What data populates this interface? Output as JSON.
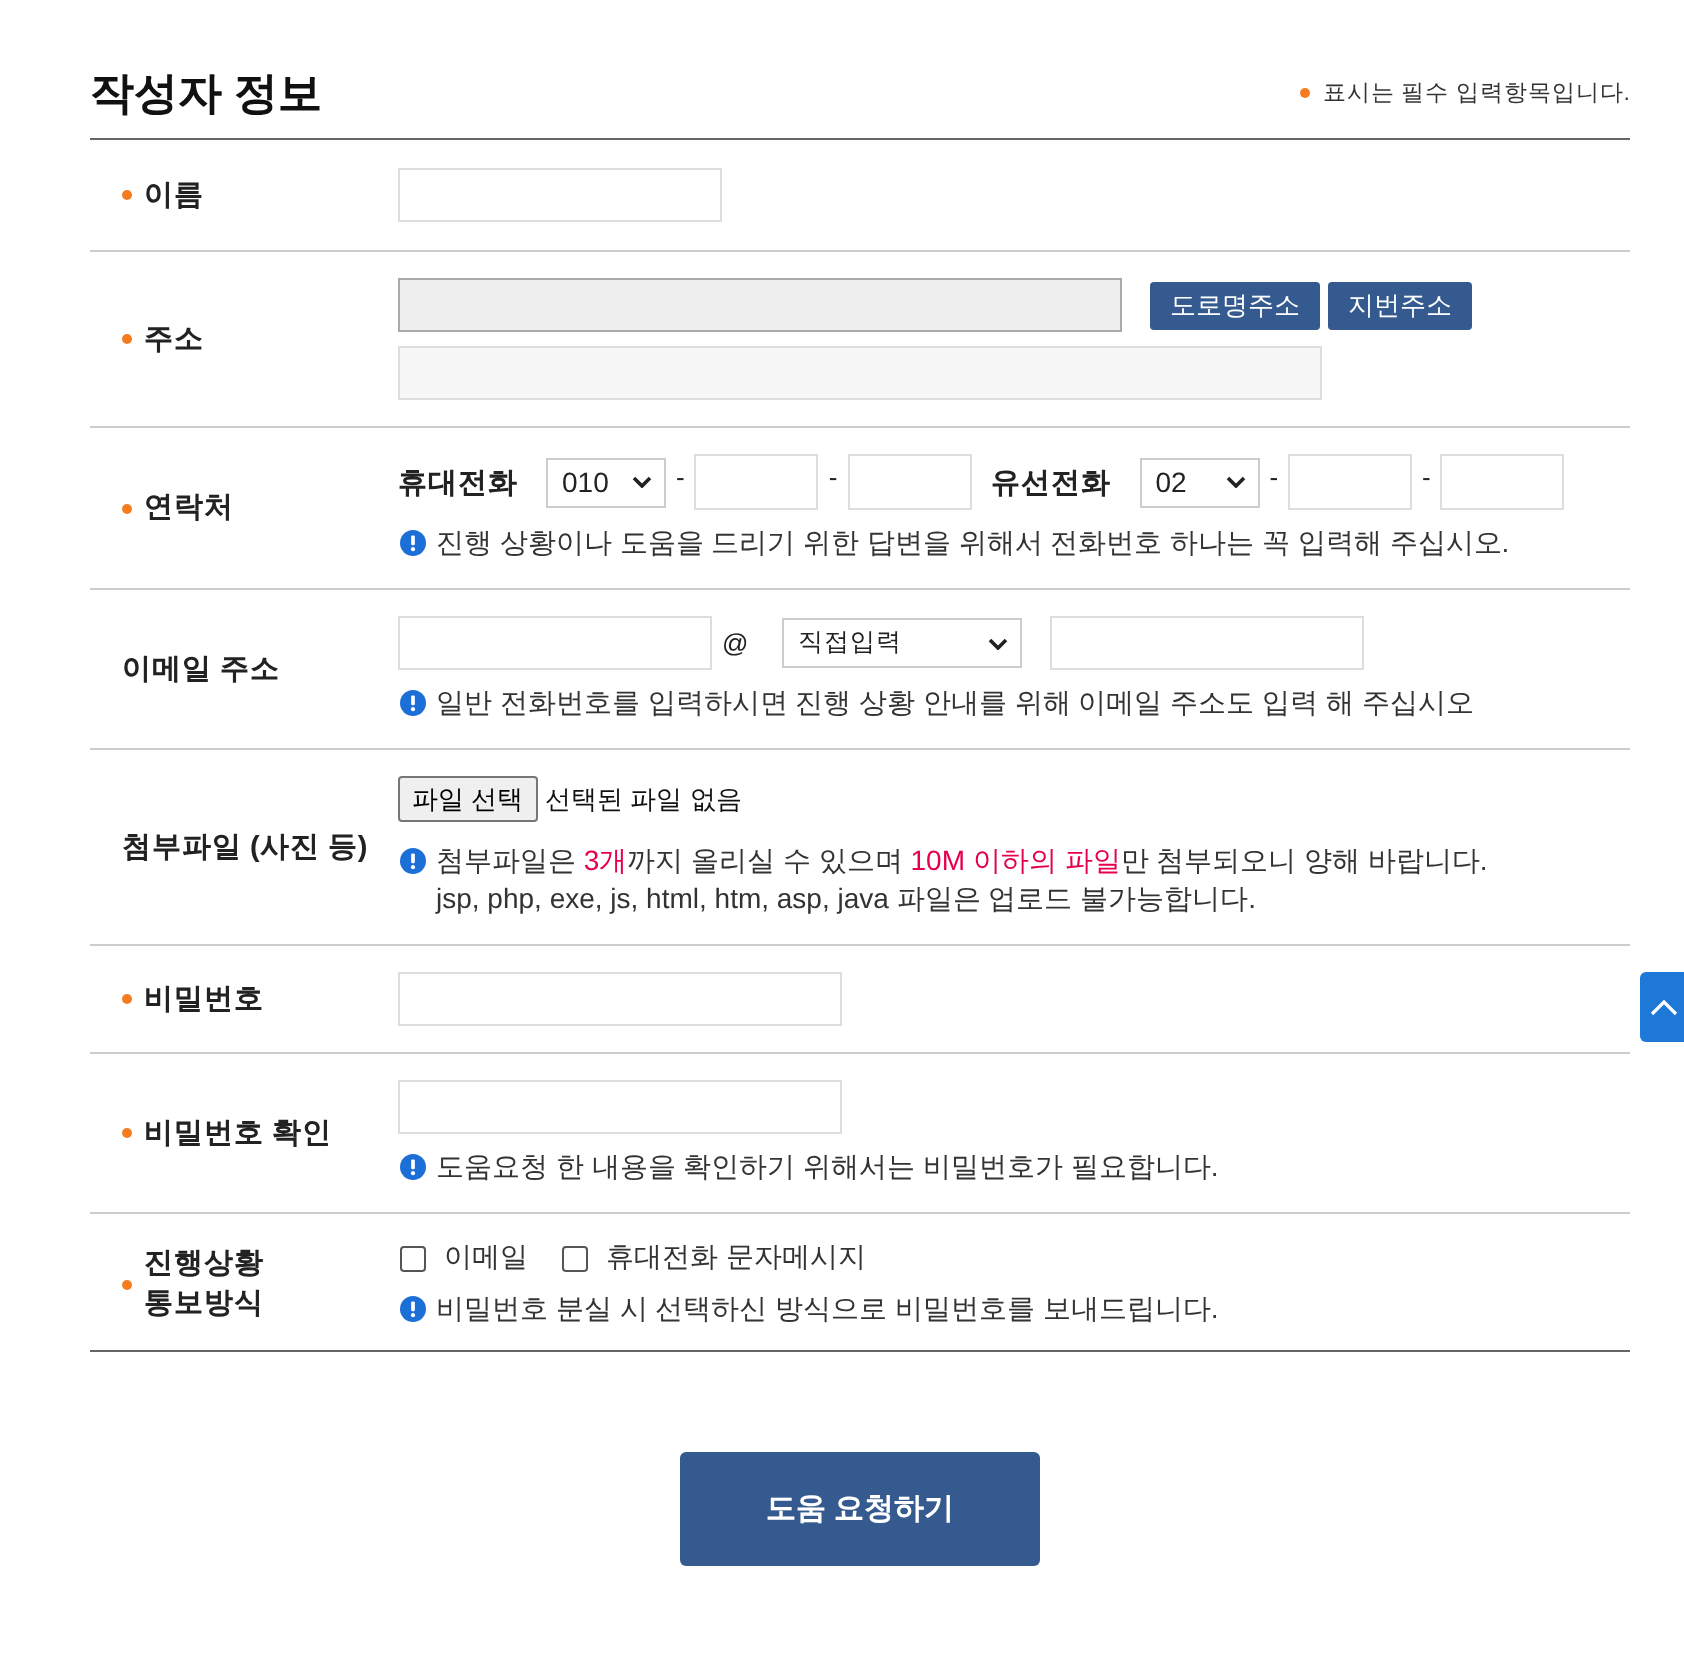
{
  "header": {
    "title": "작성자 정보",
    "required_note": "표시는 필수 입력항목입니다."
  },
  "rows": [
    {
      "kind": "text",
      "label": "이름",
      "required": true
    },
    {
      "kind": "address",
      "label": "주소",
      "required": true,
      "buttons": [
        "도로명주소",
        "지번주소"
      ]
    },
    {
      "kind": "phone",
      "label": "연락처",
      "required": true,
      "phones": [
        {
          "label": "휴대전화",
          "prefix": "010",
          "separators": [
            "-",
            "-"
          ]
        },
        {
          "label": "유선전화",
          "prefix": "02",
          "separators": [
            "-",
            "-"
          ]
        }
      ],
      "note": [
        "진행 상황이나 도움을 드리기 위한 답변을 위해서 전화번호 하나는 꼭 입력해 주십시오."
      ]
    },
    {
      "kind": "email",
      "label": "이메일 주소",
      "required": false,
      "at": "@",
      "domain": "직접입력",
      "note": [
        "일반 전화번호를 입력하시면 진행 상황 안내를 위해 이메일 주소도 입력 해 주십시오"
      ]
    },
    {
      "kind": "file",
      "label": "첨부파일 (사진 등)",
      "required": false,
      "file_button": "파일 선택",
      "file_status": "선택된 파일 없음",
      "note": [
        "첨부파일은 **3개**까지 올리실 수 있으며 **10M 이하의 파일**만 첨부되오니 양해 바랍니다.",
        "jsp, php, exe, js, html, htm, asp, java 파일은 업로드 불가능합니다."
      ]
    },
    {
      "kind": "password",
      "label": "비밀번호",
      "required": true
    },
    {
      "kind": "password",
      "label": "비밀번호 확인",
      "required": true,
      "note": [
        "도움요청 한 내용을 확인하기 위해서는 비밀번호가 필요합니다."
      ]
    },
    {
      "kind": "checkboxes",
      "label": "진행상황\n통보방식",
      "required": true,
      "options": [
        {
          "label": "이메일",
          "checked": false
        },
        {
          "label": "휴대전화 문자메시지",
          "checked": false
        }
      ],
      "note": [
        "비밀번호 분실 시 선택하신 방식으로 비밀번호를 보내드립니다."
      ]
    }
  ],
  "submit": "도움 요청하기"
}
